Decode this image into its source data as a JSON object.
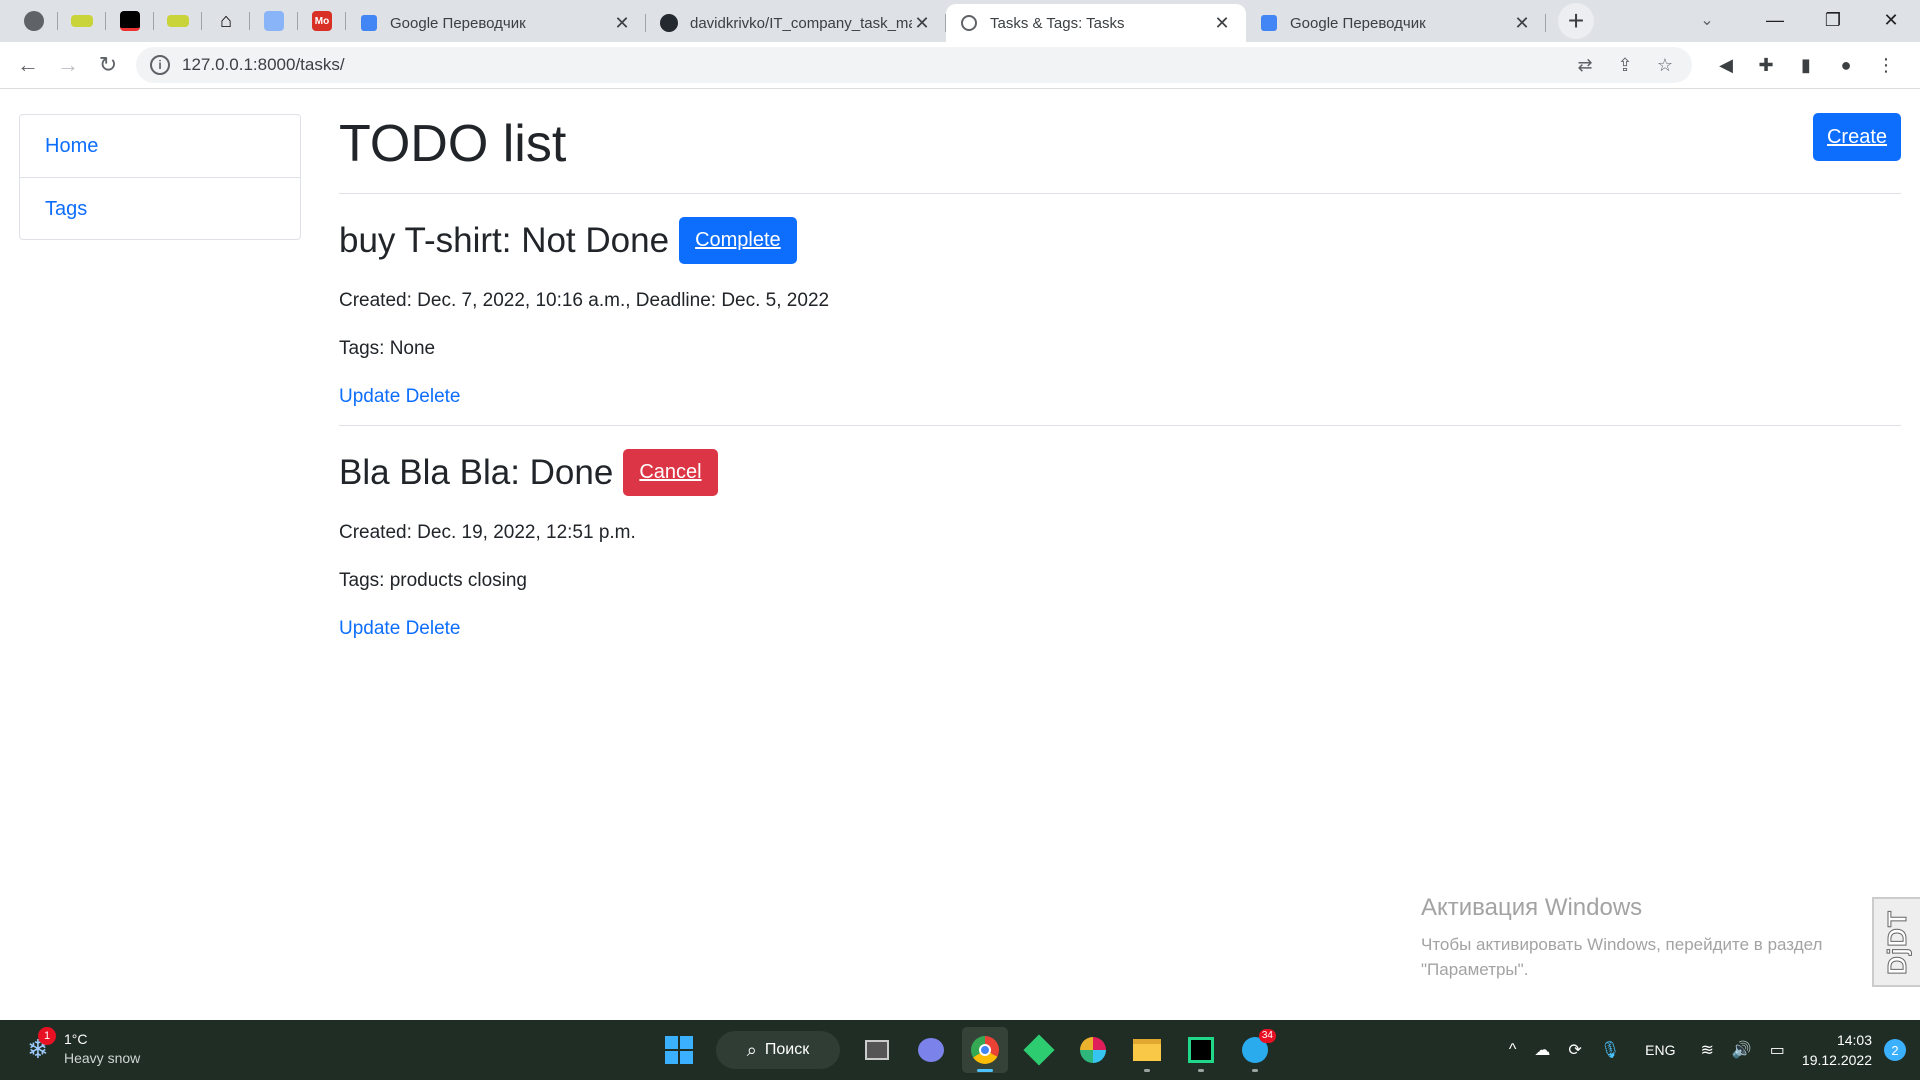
{
  "browser": {
    "tabs": [
      {
        "title": "Google Переводчик",
        "close": "✕"
      },
      {
        "title": "davidkrivko/IT_company_task_ma",
        "close": "✕"
      },
      {
        "title": "Tasks & Tags: Tasks",
        "close": "✕"
      },
      {
        "title": "Google Переводчик",
        "close": "✕"
      }
    ],
    "pinned_labels": {
      "mo": "Mo"
    },
    "url": "127.0.0.1:8000/tasks/"
  },
  "sidebar": {
    "items": [
      {
        "label": "Home"
      },
      {
        "label": "Tags"
      }
    ]
  },
  "main": {
    "title": "TODO list",
    "create_label": "Create",
    "tasks": [
      {
        "heading": "buy T-shirt: Not Done",
        "action_label": "Complete",
        "meta": "Created: Dec. 7, 2022, 10:16 a.m., Deadline: Dec. 5, 2022",
        "tags": "Tags: None",
        "update_label": "Update",
        "delete_label": "Delete"
      },
      {
        "heading": "Bla Bla Bla: Done",
        "action_label": "Cancel",
        "meta": "Created: Dec. 19, 2022, 12:51 p.m.",
        "tags": "Tags: products closing",
        "update_label": "Update",
        "delete_label": "Delete"
      }
    ]
  },
  "watermark": {
    "line1": "Активация Windows",
    "line2": "Чтобы активировать Windows, перейдите в раздел",
    "line3": "\"Параметры\"."
  },
  "debug_toolbar": {
    "label": "DjDT"
  },
  "taskbar": {
    "weather": {
      "temp": "1°C",
      "condition": "Heavy snow",
      "badge": "1"
    },
    "search_label": "Поиск",
    "telegram_badge": "34",
    "lang": "ENG",
    "time": "14:03",
    "date": "19.12.2022",
    "notifications": "2"
  },
  "colors": {
    "primary": "#0d6efd",
    "danger": "#dc3545",
    "taskbar": "#1f2d24"
  }
}
